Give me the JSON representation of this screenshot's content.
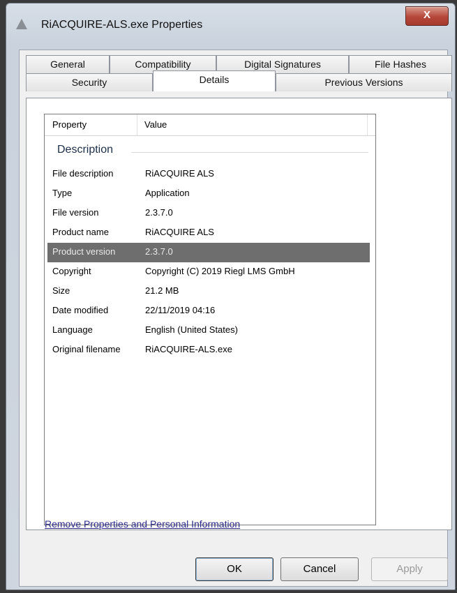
{
  "window": {
    "title": "RiACQUIRE-ALS.exe Properties",
    "close_label": "X"
  },
  "tabs_row1": [
    "General",
    "Compatibility",
    "Digital Signatures",
    "File Hashes"
  ],
  "tabs_row2": [
    "Security",
    "Details",
    "Previous Versions"
  ],
  "active_tab": "Details",
  "list": {
    "col_property": "Property",
    "col_value": "Value",
    "group": "Description",
    "rows": [
      {
        "key": "File description",
        "value": "RiACQUIRE ALS"
      },
      {
        "key": "Type",
        "value": "Application"
      },
      {
        "key": "File version",
        "value": "2.3.7.0"
      },
      {
        "key": "Product name",
        "value": "RiACQUIRE ALS"
      },
      {
        "key": "Product version",
        "value": "2.3.7.0"
      },
      {
        "key": "Copyright",
        "value": "Copyright (C) 2019 Riegl LMS GmbH"
      },
      {
        "key": "Size",
        "value": "21.2 MB"
      },
      {
        "key": "Date modified",
        "value": "22/11/2019 04:16"
      },
      {
        "key": "Language",
        "value": "English (United States)"
      },
      {
        "key": "Original filename",
        "value": "RiACQUIRE-ALS.exe"
      }
    ],
    "selected_row": "Product version"
  },
  "remove_link": "Remove Properties and Personal Information",
  "buttons": {
    "ok": "OK",
    "cancel": "Cancel",
    "apply": "Apply"
  },
  "icons": {
    "app": "application-icon",
    "close": "close-icon"
  }
}
